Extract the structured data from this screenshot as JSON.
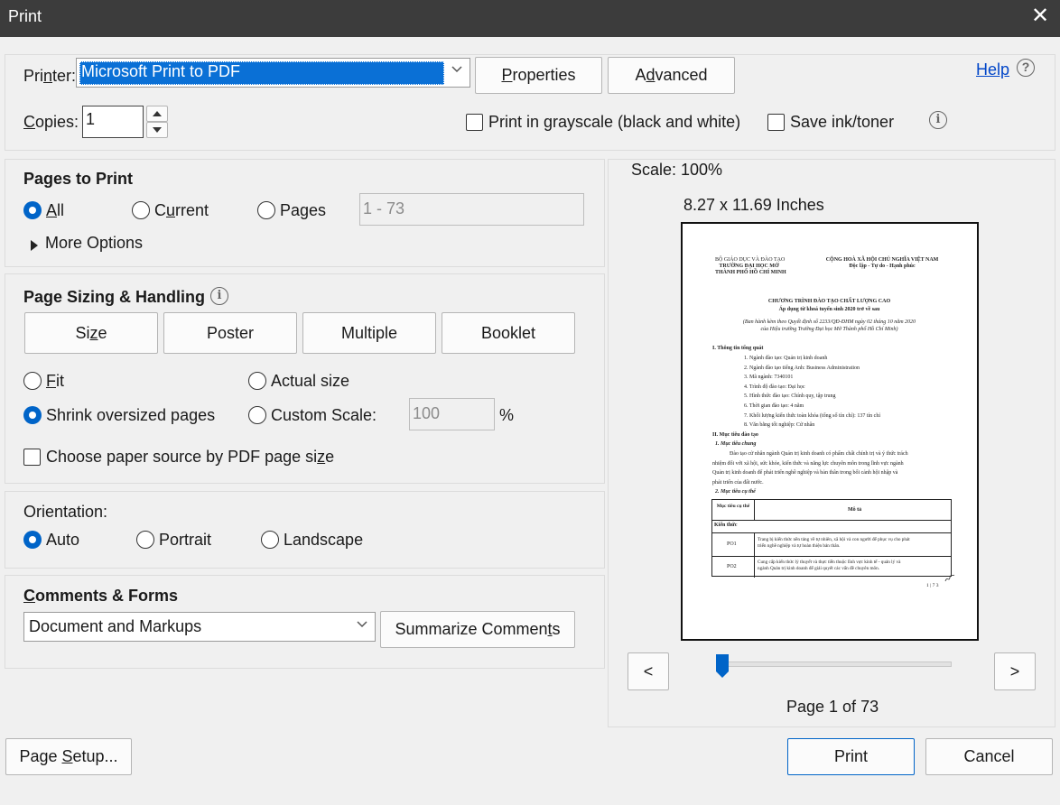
{
  "window": {
    "title": "Print",
    "close_glyph": "✕"
  },
  "printer": {
    "label": "Printer:",
    "selected": "Microsoft Print to PDF",
    "properties_label": "Properties",
    "advanced_label": "Advanced",
    "help_label": "Help",
    "help_icon": "?"
  },
  "copies": {
    "label": "Copies:",
    "value": "1"
  },
  "options": {
    "grayscale_label": "Print in grayscale (black and white)",
    "save_ink_label": "Save ink/toner",
    "info_glyph": "i"
  },
  "pages_to_print": {
    "heading": "Pages to Print",
    "all_label": "All",
    "current_label": "Current",
    "pages_label": "Pages",
    "pages_placeholder": "1 - 73",
    "more_options_label": "More Options",
    "selected": "All"
  },
  "page_sizing": {
    "heading": "Page Sizing & Handling",
    "tabs": [
      "Size",
      "Poster",
      "Multiple",
      "Booklet"
    ],
    "fit_label": "Fit",
    "actual_size_label": "Actual size",
    "shrink_label": "Shrink oversized pages",
    "custom_scale_label": "Custom Scale:",
    "custom_scale_value": "100",
    "percent": "%",
    "paper_source_label": "Choose paper source by PDF page size",
    "selected": "Shrink oversized pages"
  },
  "orientation": {
    "heading": "Orientation:",
    "auto_label": "Auto",
    "portrait_label": "Portrait",
    "landscape_label": "Landscape",
    "selected": "Auto"
  },
  "comments_forms": {
    "heading": "Comments & Forms",
    "selected": "Document and Markups",
    "summarize_label": "Summarize Comments"
  },
  "preview": {
    "scale_text": "Scale: 100%",
    "size_text": "8.27 x 11.69 Inches",
    "prev_label": "<",
    "next_label": ">",
    "page_text": "Page 1 of 73",
    "slider_fraction": 0.0137,
    "document": {
      "left_header": [
        "BỘ GIÁO DỤC VÀ ĐÀO TẠO",
        "TRƯỜNG ĐẠI HỌC MỞ",
        "THÀNH PHỐ HỒ CHÍ MINH"
      ],
      "right_header": [
        "CỘNG HOÀ XÃ HỘI CHỦ NGHĨA VIỆT NAM",
        "Độc lập - Tự do - Hạnh phúc"
      ],
      "title": "CHƯƠNG TRÌNH ĐÀO TẠO CHẤT LƯỢNG CAO",
      "subtitle": "Áp dụng từ khoá tuyển sinh 2020 trở về sau",
      "decree": [
        "(Ban hành kèm theo Quyết định số 2233/QĐ-ĐHM ngày 02 tháng 10 năm 2020",
        "của Hiệu trưởng Trường Đại học Mở Thành phố Hồ Chí Minh)"
      ],
      "section1": "I.    Thông tin tổng quát",
      "items": [
        "1.   Ngành đào tạo: Quản trị kinh doanh",
        "2.   Ngành đào tạo tiếng Anh: Business Administration",
        "3.   Mã ngành: 7340101",
        "4.   Trình độ đào tạo: Đại học",
        "5.   Hình thức đào tạo: Chính quy, tập trung",
        "6.   Thời gian đào tạo: 4 năm",
        "7.   Khối lượng kiến thức toàn khóa (tổng số tín chỉ): 137 tín chỉ",
        "8.   Văn bằng tốt nghiệp: Cử nhân"
      ],
      "section2": "II.   Mục tiêu đào tạo",
      "sub1": "1.     Mục tiêu chung",
      "para": [
        "Đào tạo cử nhân ngành Quản trị kinh doanh có phẩm chất chính trị và ý thức trách",
        "nhiệm đối với xã hội, sức khỏe, kiến thức và năng lực chuyên môn trong lĩnh vực ngành",
        "Quản trị kinh doanh để phát triển nghề nghiệp và bản thân trong bối cảnh hội nhập và",
        "phát triển của đất nước."
      ],
      "sub2": "2.     Mục tiêu cụ thể",
      "table_header": [
        "Mục tiêu cụ thể",
        "Mô tả"
      ],
      "table_group": "Kiến thức",
      "rows": [
        {
          "code": "PO1",
          "desc": [
            "Trang bị kiến thức nền tảng về tự nhiên, xã hội và con người để phục vụ cho phát",
            "triển nghề nghiệp và tự hoàn thiện bản thân."
          ]
        },
        {
          "code": "PO2",
          "desc": [
            "Cung cấp kiến thức lý thuyết và thực tiễn thuộc lĩnh vực kinh tế - quản lý và",
            "ngành Quản trị kinh doanh để giải quyết các vấn đề chuyên môn."
          ]
        }
      ],
      "page_marker": "1 | 7 3"
    }
  },
  "footer": {
    "page_setup_label": "Page Setup...",
    "print_label": "Print",
    "cancel_label": "Cancel"
  },
  "colors": {
    "accent": "#0064c8",
    "selection": "#0a70d6",
    "titlebar": "#3c3c3c",
    "link": "#0045c8"
  }
}
